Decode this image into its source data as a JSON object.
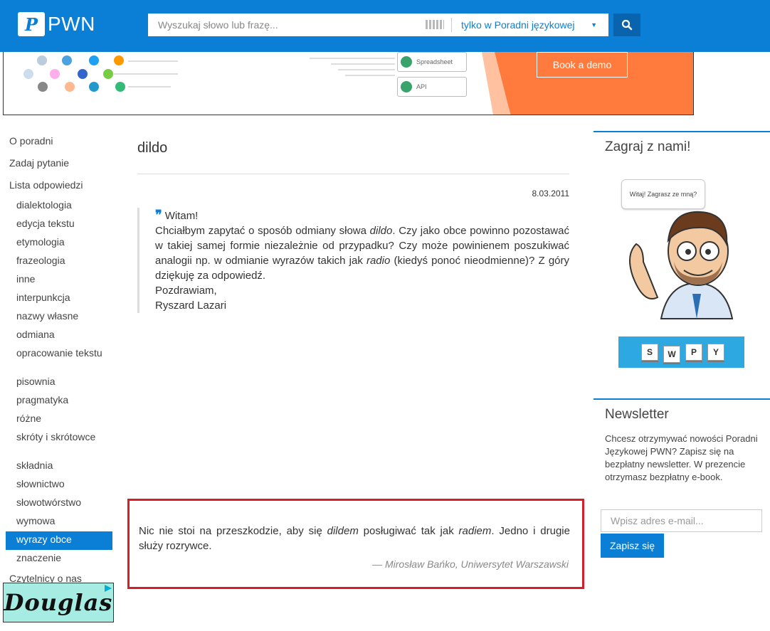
{
  "header": {
    "logo_mark": "P",
    "logo_text": "PWN",
    "search_placeholder": "Wyszukaj słowo lub frazę...",
    "scope_label": "tylko w Poradni językowej",
    "brand_color": "#0b7fd6"
  },
  "banner": {
    "pill_spreadsheet": "Spreadsheet",
    "pill_api": "API",
    "cta": "Book a demo",
    "accent_color": "#ff7a3d"
  },
  "sidebar": {
    "items": [
      {
        "label": "O poradni",
        "level": 0
      },
      {
        "label": "Zadaj pytanie",
        "level": 0
      },
      {
        "label": "Lista odpowiedzi",
        "level": 0
      },
      {
        "label": "dialektologia",
        "level": 1
      },
      {
        "label": "edycja tekstu",
        "level": 1
      },
      {
        "label": "etymologia",
        "level": 1
      },
      {
        "label": "frazeologia",
        "level": 1
      },
      {
        "label": "inne",
        "level": 1
      },
      {
        "label": "interpunkcja",
        "level": 1
      },
      {
        "label": "nazwy własne",
        "level": 1
      },
      {
        "label": "odmiana",
        "level": 1
      },
      {
        "label": "opracowanie tekstu",
        "level": 1
      },
      {
        "label": "pisownia",
        "level": 1
      },
      {
        "label": "pragmatyka",
        "level": 1
      },
      {
        "label": "różne",
        "level": 1
      },
      {
        "label": "skróty i skrótowce",
        "level": 1
      },
      {
        "label": "składnia",
        "level": 1
      },
      {
        "label": "słownictwo",
        "level": 1
      },
      {
        "label": "słowotwórstwo",
        "level": 1
      },
      {
        "label": "wymowa",
        "level": 1
      },
      {
        "label": "wyrazy obce",
        "level": 1,
        "active": true
      },
      {
        "label": "znaczenie",
        "level": 1
      },
      {
        "label": "Czytelnicy o nas",
        "level": 0
      }
    ],
    "ad_text": "Douglas"
  },
  "article": {
    "title": "dildo",
    "date": "8.03.2011",
    "greeting": "Witam!",
    "q1": "Chciałbym zapytać o sposób odmiany słowa ",
    "q1_em": "dildo",
    "q2": ". Czy jako obce powinno pozostawać w takiej samej formie niezależnie od przypadku? Czy może powinienem poszukiwać analogii np. w odmianie wyrazów takich jak ",
    "q2_em": "radio",
    "q3": " (kiedyś ponoć nieodmienne)? Z góry dziękuję za odpowiedź.",
    "closing": "Pozdrawiam,",
    "signature": "Ryszard Lazari",
    "answer_a": "Nic nie stoi na przeszkodzie, aby się ",
    "answer_em1": "dildem",
    "answer_b": " posługiwać tak jak ",
    "answer_em2": "radiem",
    "answer_c": ". Jedno i drugie służy rozrywce.",
    "answer_author": "— Mirosław Bańko, Uniwersytet Warszawski"
  },
  "game": {
    "title": "Zagraj z nami!",
    "bubble": "Witaj! Zagrasz ze mną?",
    "tiles": [
      "S",
      "W",
      "P",
      "Y"
    ]
  },
  "newsletter": {
    "title": "Newsletter",
    "text": "Chcesz otrzymywać nowości Poradni Językowej PWN? Zapisz się na bezpłatny newsletter. W prezencie otrzymasz bezpłatny e-book.",
    "email_placeholder": "Wpisz adres e-mail...",
    "submit": "Zapisz się"
  }
}
